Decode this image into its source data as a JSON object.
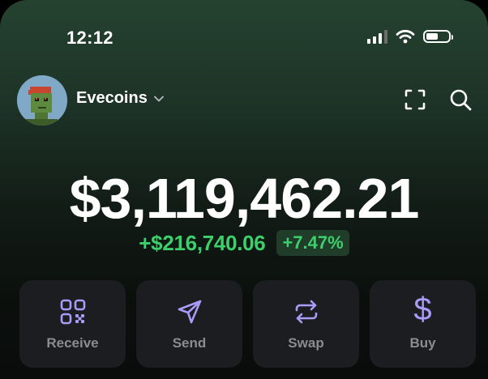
{
  "status_bar": {
    "time": "12:12",
    "icons": [
      "cellular-signal-icon",
      "wifi-icon",
      "battery-icon"
    ]
  },
  "header": {
    "wallet_name": "Evecoins",
    "avatar": "pixel-art-avatar",
    "icons": [
      "chevron-down-icon",
      "scan-icon",
      "search-icon"
    ]
  },
  "balance": {
    "total": "$3,119,462.21",
    "change_amount": "+$216,740.06",
    "change_percent": "+7.47%"
  },
  "actions": [
    {
      "label": "Receive",
      "icon": "qr-code-icon"
    },
    {
      "label": "Send",
      "icon": "send-icon"
    },
    {
      "label": "Swap",
      "icon": "swap-icon"
    },
    {
      "label": "Buy",
      "icon": "dollar-icon"
    }
  ],
  "colors": {
    "accent": "#a79cf7",
    "positive": "#3ecf6d",
    "tile_background": "#1c1d21"
  }
}
